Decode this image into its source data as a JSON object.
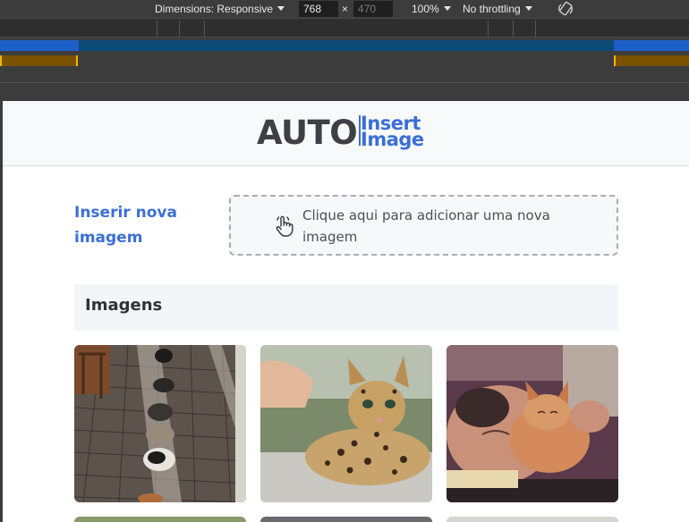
{
  "devtools": {
    "dimensions_label": "Dimensions: Responsive",
    "width_value": "768",
    "times": "×",
    "height_value": "470",
    "zoom": "100%",
    "throttling": "No throttling",
    "rotate_icon": "rotate-icon"
  },
  "header": {
    "logo_auto": "AUTO",
    "logo_insert": "Insert",
    "logo_image": "Image"
  },
  "upload": {
    "label": "Inserir nova imagem",
    "dropzone_text": "Clique aqui para adicionar uma nova imagem",
    "icon": "hand-pointer-icon"
  },
  "gallery": {
    "title": "Imagens",
    "images": [
      {
        "name": "cats-on-street"
      },
      {
        "name": "leopard-kitten"
      },
      {
        "name": "man-with-cat"
      }
    ]
  },
  "colors": {
    "brand_blue": "#3b6fd6",
    "logo_gray": "#3f3f46",
    "devtools_bg": "#3c3c3c"
  }
}
